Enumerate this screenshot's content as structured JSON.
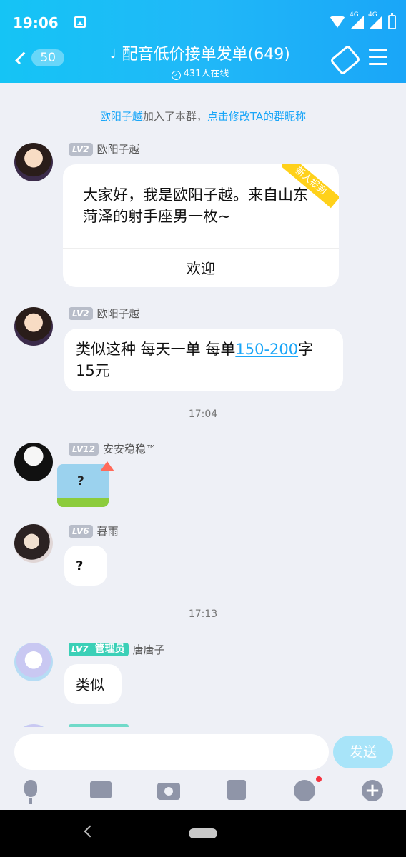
{
  "status_bar": {
    "time": "19:06",
    "network_1": "4G",
    "network_2": "4G"
  },
  "header": {
    "unread_count": "50",
    "title": "配音低价接单发单(649)",
    "online_text": "431人在线"
  },
  "chat": {
    "join_notice": {
      "name": "欧阳子越",
      "middle": "加入了本群，",
      "link": "点击修改TA的群昵称"
    },
    "messages": [
      {
        "level": "LV2",
        "sender": "欧阳子越",
        "ribbon": "新人报到",
        "text": "大家好，我是欧阳子越。来自山东菏泽的射手座男一枚~",
        "action": "欢迎"
      },
      {
        "level": "LV2",
        "sender": "欧阳子越",
        "text_before": "类似这种 每天一单 每单",
        "link": "150-200",
        "text_after": "字 15元"
      },
      {
        "level": "LV12",
        "sender": "安安稳稳™",
        "sticker_text": "?"
      },
      {
        "level": "LV6",
        "sender": "暮雨",
        "text": "?"
      },
      {
        "level": "LV7",
        "role": "管理员",
        "sender": "唐唐子",
        "text": "类似"
      }
    ],
    "timestamps": [
      "17:04",
      "17:13"
    ]
  },
  "input_bar": {
    "send_label": "发送",
    "placeholder": ""
  },
  "colors": {
    "accent": "#1aa6f8",
    "ribbon": "#ffd11a",
    "admin": "#3bd0b7"
  }
}
